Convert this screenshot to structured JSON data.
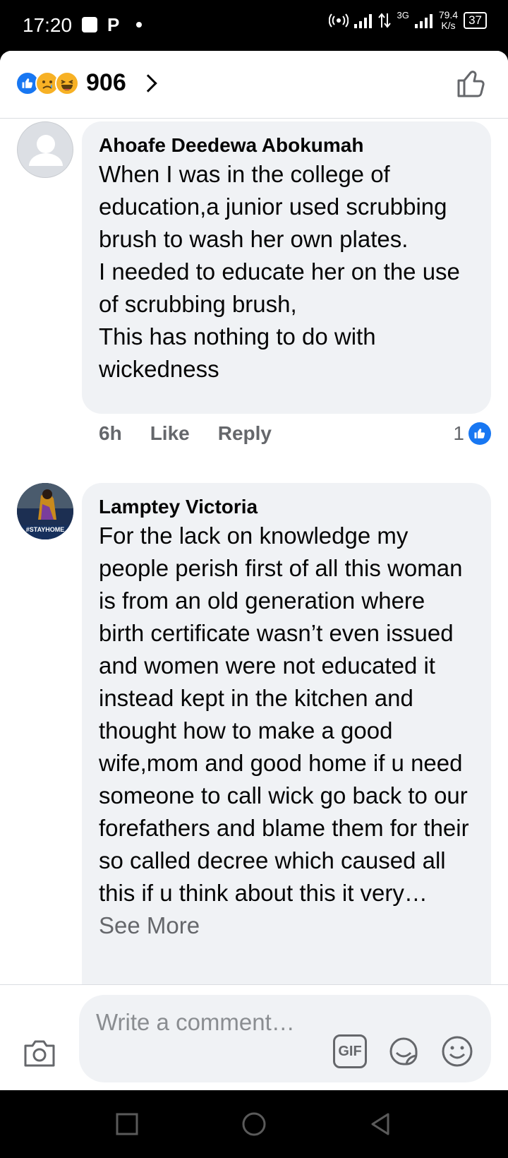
{
  "status_bar": {
    "time": "17:20",
    "p_icon": "P",
    "net_speed_value": "79.4",
    "net_speed_unit": "K/s",
    "network_type": "3G",
    "battery": "37"
  },
  "header": {
    "reaction_count": "906",
    "reaction_icons": [
      "like-icon",
      "sad-icon",
      "haha-icon"
    ]
  },
  "comments": [
    {
      "author": "Ahoafe Deedewa Abokumah",
      "text": "When I was in the college of education,a junior used scrubbing brush to wash her own plates.\nI needed to educate her on the use of scrubbing brush,\nThis has nothing to do with wickedness",
      "time": "6h",
      "like_label": "Like",
      "reply_label": "Reply",
      "like_count": "1",
      "avatar": "default-avatar"
    },
    {
      "author": "Lamptey Victoria",
      "text": "For the lack on knowledge my people perish first of all this woman is from an old generation where birth certificate wasn’t even issued and women were not educated it instead kept in the kitchen and thought how to make a good wife,mom and good home if u need someone to call wick go back to our forefathers and blame them for their so called decree which caused all this if u think about this it very… ",
      "see_more": "See More",
      "avatar_badge": "#STAYHOME"
    }
  ],
  "composer": {
    "placeholder": "Write a comment…",
    "gif_label": "GIF"
  },
  "colors": {
    "accent": "#1877f2",
    "bubble": "#f0f2f5",
    "secondary_text": "#65676b"
  }
}
